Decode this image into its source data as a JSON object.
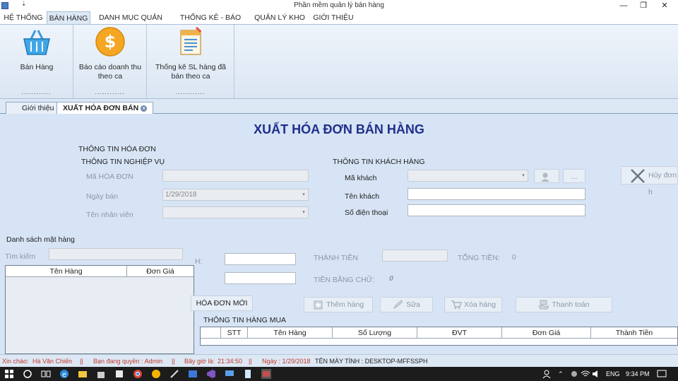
{
  "window": {
    "title": "Phần mềm quản lý bán hàng",
    "quick_access": "⇣",
    "minimize": "—",
    "restore": "❐",
    "close": "✕"
  },
  "ribbon_tabs": [
    {
      "label": "HỆ THỐNG"
    },
    {
      "label": "BÁN HÀNG"
    },
    {
      "label": "DANH MỤC QUẢN LÝ"
    },
    {
      "label": "THỐNG KÊ - BÁO CÁO"
    },
    {
      "label": "QUẢN LÝ KHO"
    },
    {
      "label": "GIỚI THIỆU"
    }
  ],
  "ribbon": {
    "sell_label": "Bán Hàng",
    "revenue_label_1": "Báo cáo doanh thu",
    "revenue_label_2": "theo ca",
    "stats_label_1": "Thống kê SL hàng đã",
    "stats_label_2": "bán theo ca",
    "group_dots": "............"
  },
  "doc_tabs": {
    "intro": "Giới thiệu",
    "invoice": "XUẤT HÓA ĐƠN BÁN",
    "close_glyph": "x"
  },
  "form": {
    "title": "XUẤT HÓA ĐƠN BÁN HÀNG",
    "invoice_info": "THÔNG TIN HÓA ĐƠN",
    "business_info": "THÔNG TIN NGHIỆP VỤ",
    "invoice_code_label": "Mã HÓA ĐƠN",
    "sale_date_label": "Ngày bán",
    "sale_date_value": "1/29/2018",
    "employee_label": "Tên nhân viên",
    "customer_info": "THÔNG TIN KHÁCH HÀNG",
    "customer_code_label": "Mã khách",
    "customer_name_label": "Tên khách",
    "phone_label": "Số điện thoại",
    "more_button": "...",
    "cancel_invoice": "Hủy đơn h",
    "product_list_title": "Danh sách mặt hàng",
    "search_label": "Tìm kiếm",
    "product_grid_headers": [
      "Tên Hàng",
      "Đơn Giá"
    ],
    "qty_label_fragment": "H:",
    "total_item_label": "THÀNH TIỀN",
    "grand_total_label": "TỔNG TIỀN:",
    "grand_total_value": "0",
    "amount_words_label": "TIỀN BẰNG CHỮ:",
    "amount_words_value": "0",
    "new_invoice_button": "HÓA ĐƠN MỚI",
    "add_item_button": "Thêm hàng",
    "edit_button": "Sửa",
    "delete_item_button": "Xóa hàng",
    "pay_button": "Thanh toán",
    "purchased_title": "THÔNG TIN HÀNG MUA",
    "purchased_headers": [
      "STT",
      "Tên Hàng",
      "Số Lượng",
      "ĐVT",
      "Đơn Giá",
      "Thành Tiền"
    ]
  },
  "status": {
    "greeting_label": "Xin chào:",
    "user_name": "Hà Văn Chiến",
    "sep": "||",
    "permission": "Bạn đang quyền : Admin",
    "time_label": "Bây giờ là:",
    "time_value": "21:34:50",
    "date": "Ngày : 1/29/2018",
    "machine": "TÊN MÁY TÍNH : DESKTOP-MFFSSPH"
  },
  "taskbar": {
    "language": "ENG",
    "clock": "9:34 PM"
  },
  "colors": {
    "title_navy": "#1f2f8a",
    "status_red": "#c0392b",
    "form_bg": "#d6e4f5"
  }
}
